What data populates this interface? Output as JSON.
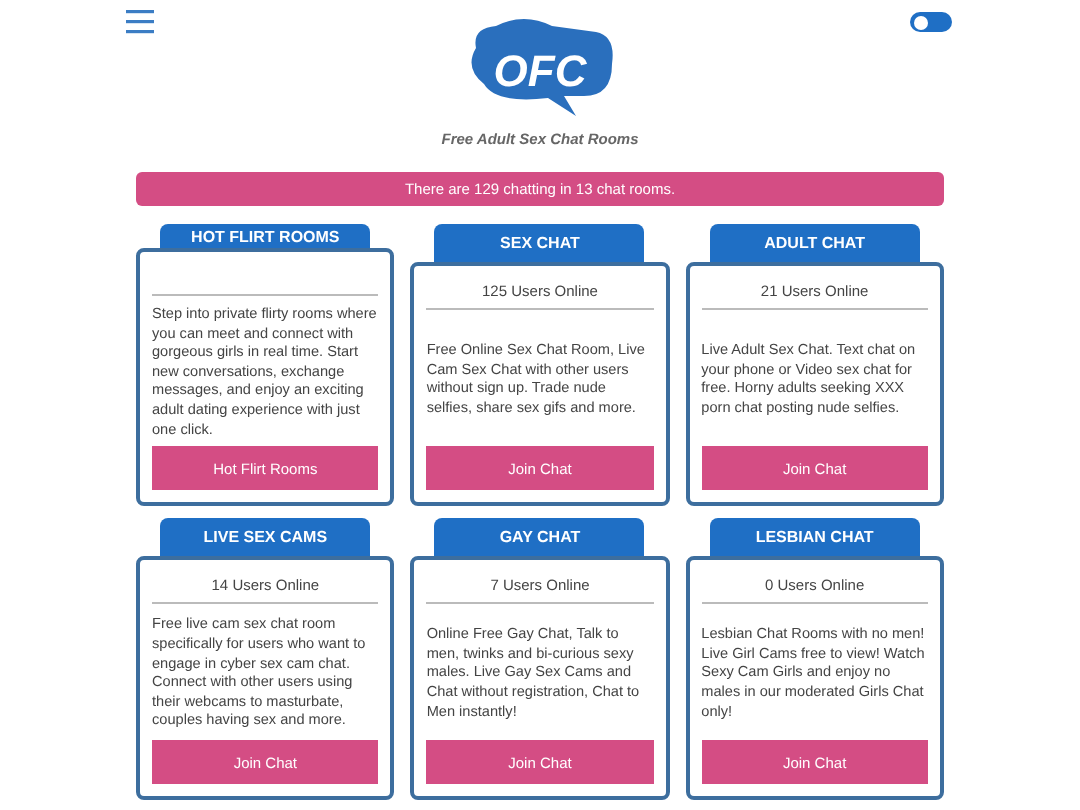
{
  "header": {
    "logo_text": "OFC",
    "tagline": "Free Adult Sex Chat Rooms",
    "dark_mode": {
      "on": false
    }
  },
  "banner": "There are 129 chatting in 13 chat rooms.",
  "rooms": [
    {
      "title": "HOT FLIRT ROOMS",
      "description": "Step into private flirty rooms where you can meet and connect with gorgeous girls in real time. Start new conversations, exchange messages, and enjoy an exciting adult dating experience with just one click.",
      "button": "Hot Flirt Rooms"
    },
    {
      "title": "SEX CHAT",
      "users_online": "125 Users Online",
      "description": "Free Online Sex Chat Room, Live Cam Sex Chat with other users without sign up. Trade nude selfies, share sex gifs and more.",
      "button": "Join Chat"
    },
    {
      "title": "ADULT CHAT",
      "users_online": "21 Users Online",
      "description": "Live Adult Sex Chat. Text chat on your phone or Video sex chat for free. Horny adults seeking XXX porn chat posting nude selfies.",
      "button": "Join Chat"
    },
    {
      "title": "LIVE SEX CAMS",
      "users_online": "14 Users Online",
      "description": "Free live cam sex chat room specifically for users who want to engage in cyber sex cam chat. Connect with other users using their webcams to masturbate, couples having sex and more.",
      "button": "Join Chat"
    },
    {
      "title": "GAY CHAT",
      "users_online": "7 Users Online",
      "description": "Online Free Gay Chat, Talk to men, twinks and bi-curious sexy males. Live Gay Sex Cams and Chat without registration, Chat to Men instantly!",
      "button": "Join Chat"
    },
    {
      "title": "LESBIAN CHAT",
      "users_online": "0 Users Online",
      "description": "Lesbian Chat Rooms with no men! Live Girl Cams free to view! Watch Sexy Cam Girls and enjoy no males in our moderated Girls Chat only!",
      "button": "Join Chat"
    }
  ]
}
